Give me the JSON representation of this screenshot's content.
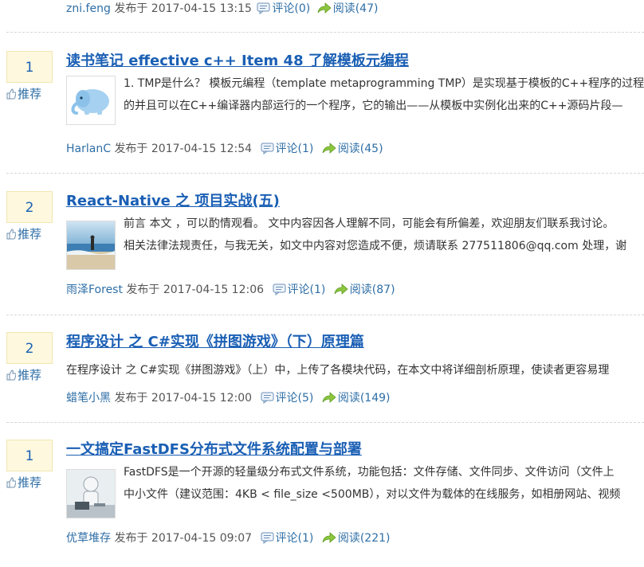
{
  "labels": {
    "posted_at_prefix": "发布于",
    "digg_button": "推荐"
  },
  "top_meta": {
    "author": "zni.feng",
    "datetime": "2017-04-15 13:15",
    "comments": "评论(0)",
    "reads": "阅读(47)"
  },
  "posts": [
    {
      "digg_count": "1",
      "title": "读书笔记 effective c++ Item 48 了解模板元编程",
      "summary_lines": [
        "1. TMP是什么？ 模板元编程（template metaprogramming TMP）是实现基于模板的C++程序的过程",
        "的并且可以在C++编译器内部运行的一个程序，它的输出——从模板中实例化出来的C++源码片段—"
      ],
      "author": "HarlanC",
      "datetime": "2017-04-15 12:54",
      "comments": "评论(1)",
      "reads": "阅读(45)"
    },
    {
      "digg_count": "2",
      "title": "React-Native 之 项目实战(五)",
      "summary_lines": [
        "前言 本文 ，可以酌情观看。 文中内容因各人理解不同，可能会有所偏差，欢迎朋友们联系我讨论。",
        "相关法律法规责任，与我无关，如文中内容对您造成不便，烦请联系 277511806@qq.com 处理，谢"
      ],
      "author": "雨泽Forest",
      "datetime": "2017-04-15 12:06",
      "comments": "评论(1)",
      "reads": "阅读(87)"
    },
    {
      "digg_count": "2",
      "title": "程序设计 之 C#实现《拼图游戏》（下）原理篇",
      "summary_lines": [
        "在程序设计 之 C#实现《拼图游戏》（上）中，上传了各模块代码，在本文中将详细剖析原理，使读者更容易理"
      ],
      "author": "蜡笔小黑",
      "datetime": "2017-04-15 12:00",
      "comments": "评论(5)",
      "reads": "阅读(149)"
    },
    {
      "digg_count": "1",
      "title": "一文搞定FastDFS分布式文件系统配置与部署",
      "summary_lines": [
        "FastDFS是一个开源的轻量级分布式文件系统，功能包括：文件存储、文件同步、文件访问（文件上",
        "中小文件（建议范围：4KB < file_size <500MB），对以文件为载体的在线服务，如相册网站、视频"
      ],
      "author": "优草堆存",
      "datetime": "2017-04-15 09:07",
      "comments": "评论(1)",
      "reads": "阅读(221)"
    }
  ]
}
